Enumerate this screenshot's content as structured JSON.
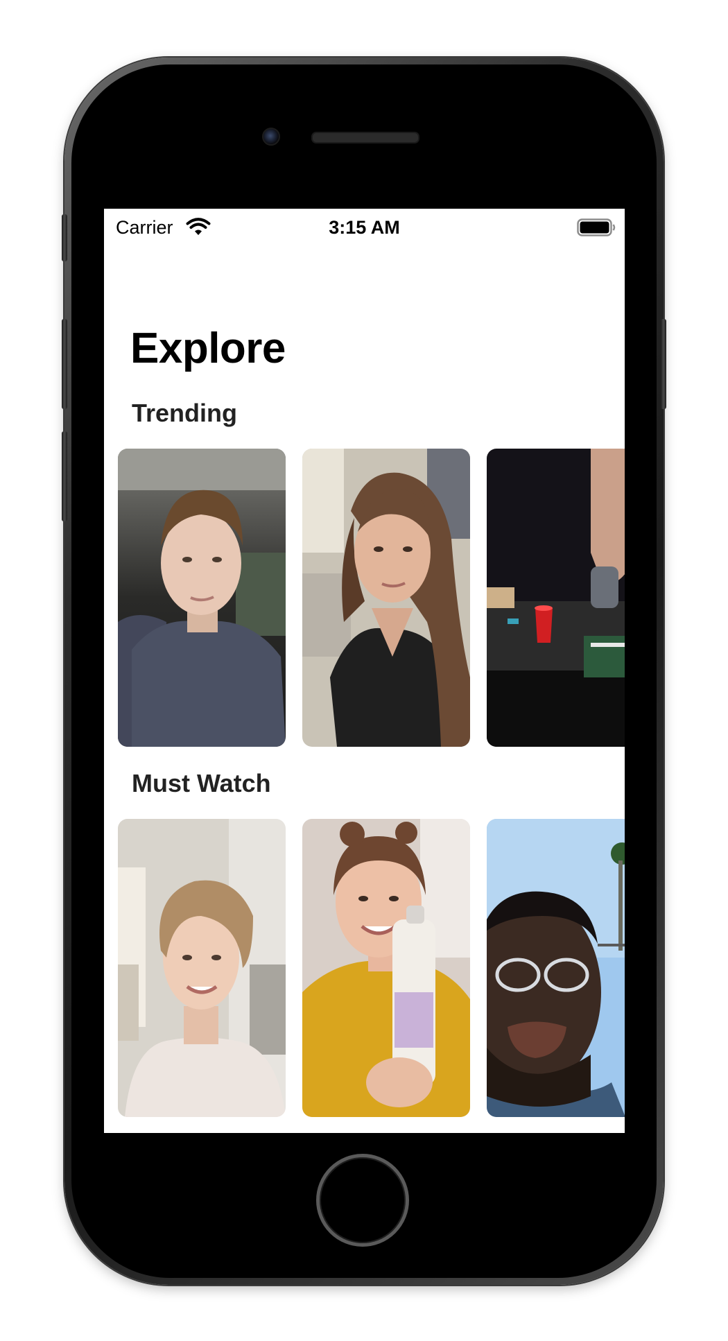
{
  "status_bar": {
    "carrier": "Carrier",
    "time": "3:15 AM"
  },
  "page": {
    "title": "Explore"
  },
  "sections": [
    {
      "title": "Trending",
      "videos": [
        {
          "thumbnail": "young-man-in-car-selfie"
        },
        {
          "thumbnail": "woman-long-hair-sunlight-selfie"
        },
        {
          "thumbnail": "table-with-red-cup-game"
        }
      ]
    },
    {
      "title": "Must Watch",
      "videos": [
        {
          "thumbnail": "smiling-woman-short-hair"
        },
        {
          "thumbnail": "woman-holding-dove-spray"
        },
        {
          "thumbnail": "man-with-glasses-outdoors"
        }
      ]
    }
  ],
  "icons": {
    "wifi": "wifi-icon",
    "battery": "battery-icon"
  },
  "colors": {
    "frame": "#1a1a1a",
    "screen_background": "#ffffff",
    "title_text": "#000000"
  }
}
